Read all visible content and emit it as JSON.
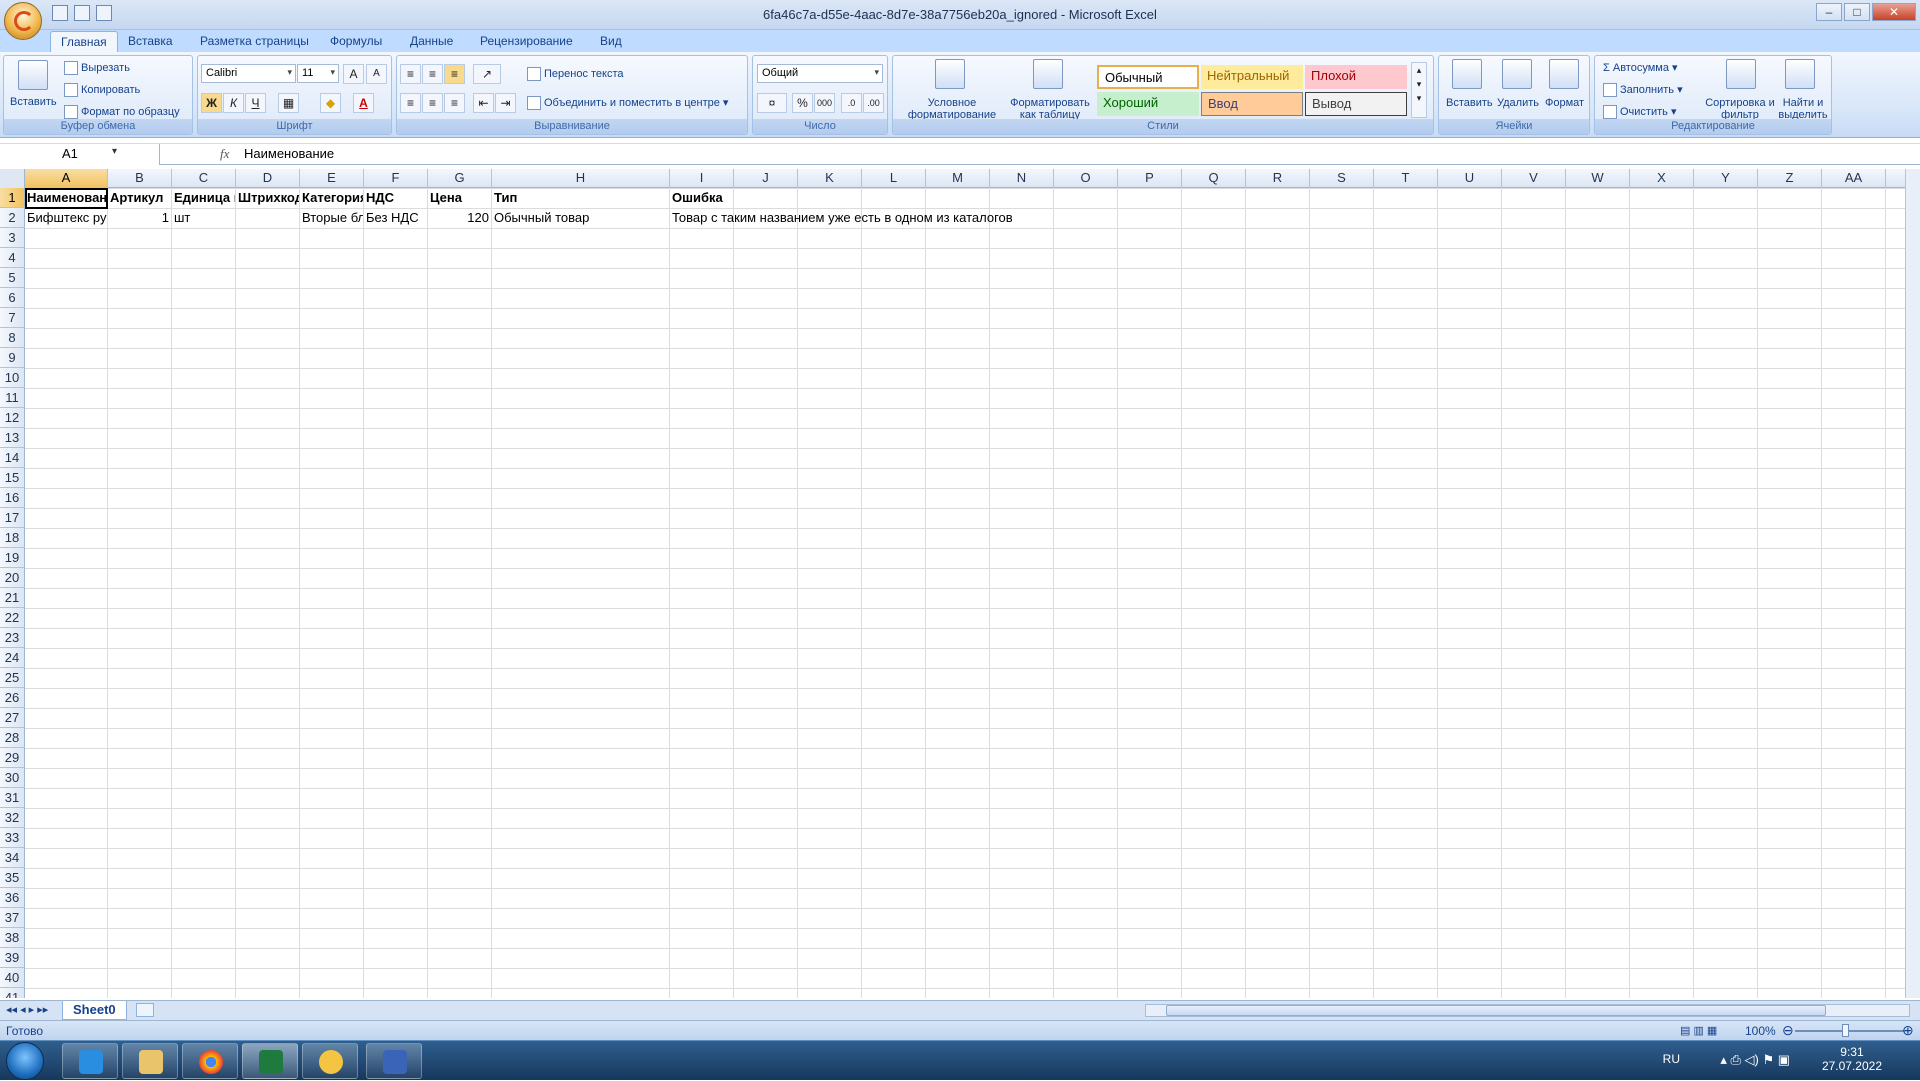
{
  "window": {
    "title": "6fa46c7a-d55e-4aac-8d7e-38a7756eb20a_ignored - Microsoft Excel"
  },
  "tabs": [
    "Главная",
    "Вставка",
    "Разметка страницы",
    "Формулы",
    "Данные",
    "Рецензирование",
    "Вид"
  ],
  "ribbon": {
    "clipboard": {
      "label": "Буфер обмена",
      "paste": "Вставить",
      "cut": "Вырезать",
      "copy": "Копировать",
      "format_painter": "Формат по образцу"
    },
    "font": {
      "label": "Шрифт",
      "name": "Calibri",
      "size": "11",
      "bold": "Ж",
      "italic": "К",
      "underline": "Ч"
    },
    "alignment": {
      "label": "Выравнивание",
      "wrap": "Перенос текста",
      "merge": "Объединить и поместить в центре"
    },
    "number": {
      "label": "Число",
      "format": "Общий",
      "percent": "%",
      "thousands": "000"
    },
    "styles": {
      "label": "Стили",
      "conditional": "Условное форматирование",
      "as_table": "Форматировать как таблицу",
      "normal": "Обычный",
      "neutral": "Нейтральный",
      "bad": "Плохой",
      "good": "Хороший",
      "input": "Ввод",
      "output": "Вывод"
    },
    "cells": {
      "label": "Ячейки",
      "insert": "Вставить",
      "delete": "Удалить",
      "format": "Формат"
    },
    "editing": {
      "label": "Редактирование",
      "autosum": "Автосумма",
      "fill": "Заполнить",
      "clear": "Очистить",
      "sort": "Сортировка и фильтр",
      "find": "Найти и выделить"
    }
  },
  "formula_bar": {
    "name_box": "A1",
    "fx": "fx",
    "content": "Наименование"
  },
  "columns": [
    "A",
    "B",
    "C",
    "D",
    "E",
    "F",
    "G",
    "H",
    "I",
    "J",
    "K",
    "L",
    "M",
    "N",
    "O",
    "P",
    "Q",
    "R",
    "S",
    "T",
    "U",
    "V",
    "W",
    "X",
    "Y",
    "Z",
    "AA"
  ],
  "rows": [
    "1",
    "2",
    "3",
    "4",
    "5",
    "6",
    "7",
    "8",
    "9",
    "10",
    "11",
    "12",
    "13",
    "14",
    "15",
    "16",
    "17",
    "18",
    "19",
    "20",
    "21",
    "22",
    "23",
    "24",
    "25",
    "26",
    "27",
    "28",
    "29",
    "30",
    "31",
    "32",
    "33",
    "34",
    "35",
    "36",
    "37",
    "38",
    "39",
    "40",
    "41"
  ],
  "cells": {
    "headers": [
      "Наименование",
      "Артикул",
      "Единица измерения",
      "Штрихкод",
      "Категория",
      "НДС",
      "Цена",
      "Тип",
      "Ошибка"
    ],
    "row2": [
      "Бифштекс рубленый",
      "1",
      "шт",
      "",
      "Вторые блюда",
      "Без НДС",
      "120",
      "Обычный товар",
      "Товар с таким названием уже есть в одном из каталогов"
    ]
  },
  "sheet_tab": "Sheet0",
  "status": {
    "ready": "Готово",
    "zoom": "100%"
  },
  "taskbar": {
    "lang": "RU",
    "time": "9:31",
    "date": "27.07.2022"
  }
}
